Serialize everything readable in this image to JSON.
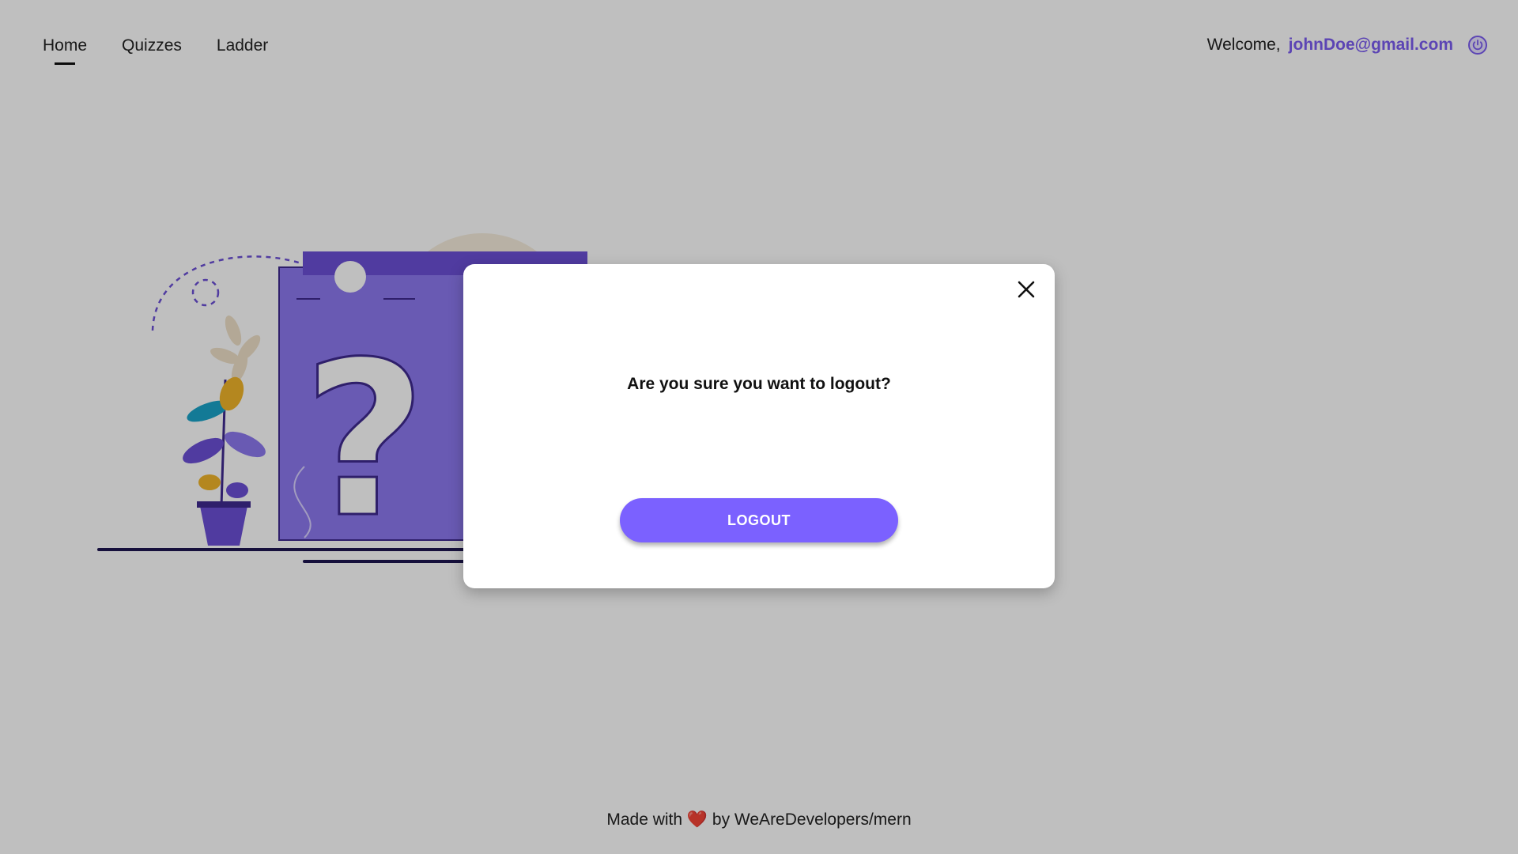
{
  "nav": {
    "links": [
      {
        "label": "Home",
        "active": true
      },
      {
        "label": "Quizzes",
        "active": false
      },
      {
        "label": "Ladder",
        "active": false
      }
    ],
    "welcome_label": "Welcome,",
    "user_email": "johnDoe@gmail.com",
    "logout_icon": "power-icon"
  },
  "modal": {
    "question": "Are you sure you want to logout?",
    "logout_label": "LOGOUT",
    "close_icon": "close-icon"
  },
  "footer": {
    "made_with": "Made with",
    "heart": "❤️",
    "by_text": "by WeAreDevelopers/mern"
  },
  "colors": {
    "accent": "#7b5cf0",
    "button": "#7b61ff",
    "overlay": "rgba(0,0,0,0.25)"
  }
}
